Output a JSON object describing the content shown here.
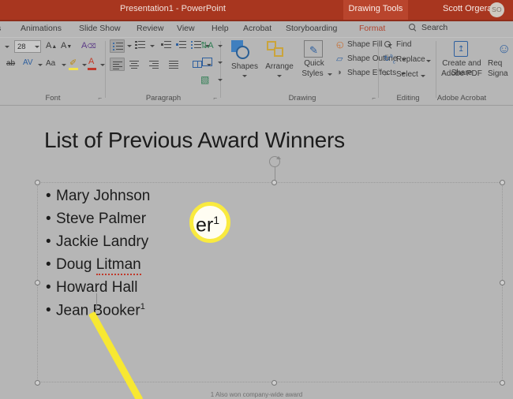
{
  "titlebar": {
    "document_title": "Presentation1  -  PowerPoint",
    "contextual_tab": "Drawing Tools",
    "user_name": "Scott Orgera",
    "avatar_initials": "SO",
    "bg_color": "#a8361f",
    "contextual_tab_bg": "#b9452d"
  },
  "tabs": [
    {
      "label": "s",
      "active": false
    },
    {
      "label": "Animations",
      "active": false
    },
    {
      "label": "Slide Show",
      "active": false
    },
    {
      "label": "Review",
      "active": false
    },
    {
      "label": "View",
      "active": false
    },
    {
      "label": "Help",
      "active": false
    },
    {
      "label": "Acrobat",
      "active": false
    },
    {
      "label": "Storyboarding",
      "active": false
    },
    {
      "label": "Format",
      "active": true
    }
  ],
  "search": {
    "label": "Search",
    "icon": "search-icon"
  },
  "ribbon": {
    "groups": [
      {
        "name": "Font",
        "label": "Font"
      },
      {
        "name": "Paragraph",
        "label": "Paragraph"
      },
      {
        "name": "Drawing",
        "label": "Drawing"
      },
      {
        "name": "Editing",
        "label": "Editing"
      },
      {
        "name": "AdobeAcrobat",
        "label": "Adobe Acrobat"
      }
    ],
    "font": {
      "size_value": "28",
      "grow_font": "A",
      "shrink_font": "A",
      "clear_formatting": "A",
      "strikethrough": "ab",
      "character_spacing": "AV",
      "change_case": "Aa",
      "text_highlight": "A",
      "font_color": "A"
    },
    "paragraph": {
      "bullets": "Bullets",
      "numbering": "Numbering",
      "decrease_indent": "Decrease List Level",
      "increase_indent": "Increase List Level",
      "line_spacing": "Line Spacing",
      "text_direction": "Text Direction",
      "align_text": "Align Text",
      "convert_smartart": "Convert to SmartArt",
      "align_left": "Align Left",
      "center": "Center",
      "align_right": "Align Right",
      "justify": "Justify",
      "columns": "Columns"
    },
    "drawing": {
      "shapes": "Shapes",
      "arrange": "Arrange",
      "quick_styles_line1": "Quick",
      "quick_styles_line2": "Styles",
      "shape_fill": "Shape Fill",
      "shape_outline": "Shape Outline",
      "shape_effects": "Shape Effects"
    },
    "editing": {
      "find": "Find",
      "replace": "Replace",
      "select": "Select"
    },
    "acrobat": {
      "create_share_line1": "Create and Share",
      "create_share_line2": "Adobe PDF",
      "request_sig_line1": "Req",
      "request_sig_line2": "Signa"
    }
  },
  "slide": {
    "title": "List of Previous Award Winners",
    "bullet_char": "•",
    "items": [
      {
        "text": "Mary Johnson",
        "misspelled_word": "",
        "footnote_marker": ""
      },
      {
        "text": "Steve Palmer",
        "misspelled_word": "",
        "footnote_marker": ""
      },
      {
        "text": "Jackie Landry",
        "misspelled_word": "",
        "footnote_marker": ""
      },
      {
        "text": "Doug ",
        "misspelled_word": "Litman",
        "footnote_marker": ""
      },
      {
        "text": "Howard Hall",
        "misspelled_word": "",
        "footnote_marker": ""
      },
      {
        "text": "Jean Booker",
        "misspelled_word": "",
        "footnote_marker": "1"
      }
    ],
    "footnote": "1 Also won company-wide award",
    "magnifier": {
      "text": "er",
      "superscript": "1",
      "ring_color": "#f9ea3f",
      "fill_color": "#fffdf2"
    }
  }
}
